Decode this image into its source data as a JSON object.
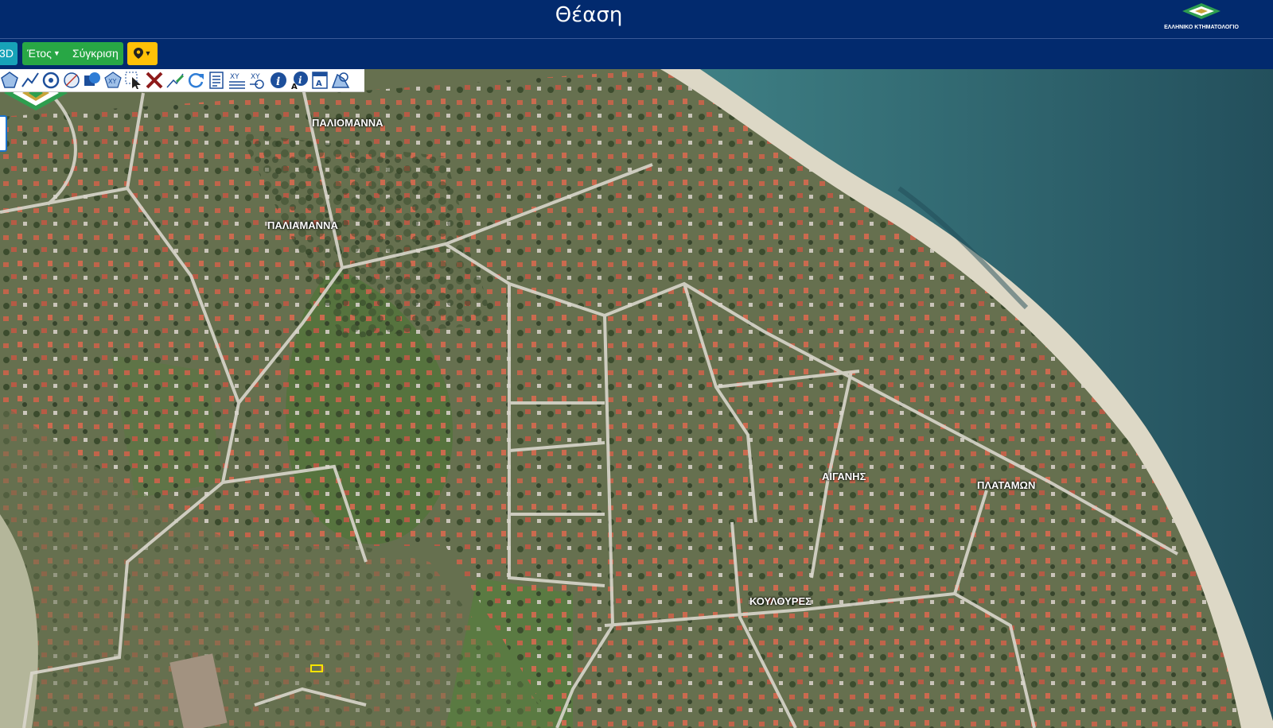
{
  "header": {
    "title": "Θέαση",
    "logo_text": "ΕΛΛΗΝΙΚΟ ΚΤΗΜΑΤΟΛΟΓΙΟ"
  },
  "buttons": {
    "view3d": "3D",
    "year": "Έτος",
    "compare": "Σύγκριση",
    "location_icon": "map-marker-icon"
  },
  "toolbar": {
    "tools": [
      "polygon-icon",
      "polyline-icon",
      "circle-icon",
      "freehand-icon",
      "shape-fill-icon",
      "xy-polygon-icon",
      "select-icon",
      "delete-icon",
      "measure-icon",
      "refresh-icon",
      "report-icon",
      "xy-coordinates-icon",
      "xy-goto-icon",
      "info-icon",
      "info-text-icon",
      "print-icon",
      "area-icon"
    ]
  },
  "map": {
    "places": [
      "ΠΑΛΙΟΜΑΝΝΑ",
      "ΠΑΛΙΑΜΑΝΝΑ",
      "ΑΙΓΑΝΗΣ",
      "ΠΛΑΤΑΜΩΝ",
      "ΚΟΥΛΟΥΡΕΣ"
    ]
  },
  "colors": {
    "header": "#022a6e",
    "btn_3d": "#17a2b8",
    "btn_group": "#28a745",
    "btn_location": "#ffc107",
    "sea": "#2f6b73"
  }
}
